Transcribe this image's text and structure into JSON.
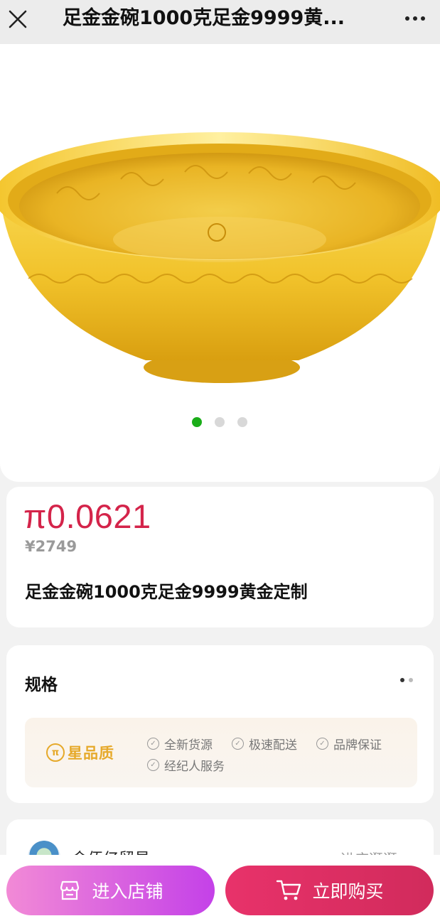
{
  "header": {
    "title": "足金金碗1000克足金9999黄...",
    "close_icon": "close-icon",
    "more_icon": "more-icon"
  },
  "gallery": {
    "image": "gold-bowl-image",
    "image_count": 3,
    "active_index": 0,
    "colors": {
      "active_dot": "#1aad19",
      "inactive_dot": "#d8d8d8"
    }
  },
  "product": {
    "price": "π0.0621",
    "original_price": "¥2749",
    "name": "足金金碗1000克足金9999黄金定制",
    "colors": {
      "price": "#d4244a"
    }
  },
  "spec": {
    "label": "规格"
  },
  "quality": {
    "logo_symbol": "π",
    "logo_text": "星品质",
    "items": [
      "全新货源",
      "极速配送",
      "品牌保证",
      "经纪人服务"
    ]
  },
  "shop": {
    "name": "金佰亿贸易",
    "link": "进店逛逛 ›"
  },
  "actions": {
    "enter_shop": "进入店铺",
    "buy_now": "立即购买",
    "colors": {
      "buy": "#e8326a",
      "shop_start": "#f28ad6",
      "shop_end": "#c441e8"
    }
  }
}
